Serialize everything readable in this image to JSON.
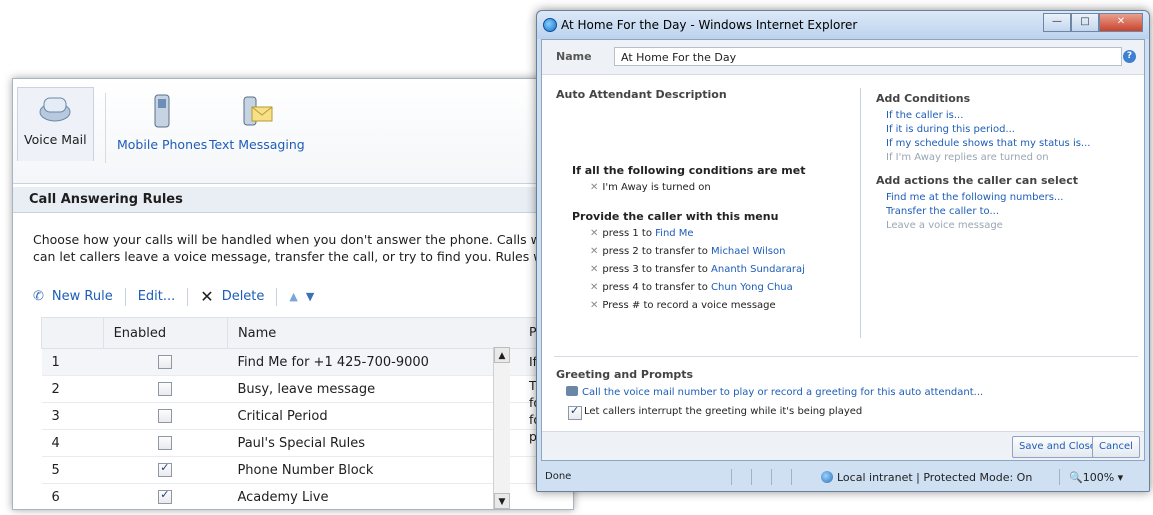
{
  "back_window": {
    "tabs": [
      {
        "label": "Voice Mail",
        "icon": "voicemail-icon"
      },
      {
        "label": "Mobile Phones",
        "icon": "mobile-phone-icon"
      },
      {
        "label": "Text Messaging",
        "icon": "text-message-icon"
      }
    ],
    "section_title": "Call Answering Rules",
    "description_line1": "Choose how your calls will be handled when you don't answer the phone. Calls will be",
    "description_line2": "can let callers leave a voice message, transfer the call, or try to find you. Rules will b",
    "toolbar": {
      "new_rule": "New Rule",
      "edit": "Edit...",
      "delete": "Delete"
    },
    "grid": {
      "columns": [
        "Enabled",
        "Name",
        "Pr"
      ],
      "rows": [
        {
          "num": "1",
          "enabled": false,
          "name": "Find Me for +1 425-700-9000"
        },
        {
          "num": "2",
          "enabled": false,
          "name": "Busy, leave message"
        },
        {
          "num": "3",
          "enabled": false,
          "name": "Critical Period"
        },
        {
          "num": "4",
          "enabled": false,
          "name": "Paul's Special Rules"
        },
        {
          "num": "5",
          "enabled": true,
          "name": "Phone Number Block"
        },
        {
          "num": "6",
          "enabled": true,
          "name": "Academy Live"
        }
      ],
      "preview_fragments": [
        "If",
        "Th",
        "fo",
        "fo",
        "pr"
      ]
    }
  },
  "ie_window": {
    "title": "At Home For the Day - Windows Internet Explorer",
    "name_label": "Name",
    "name_value": "At Home For the Day",
    "aa_title": "Auto Attendant Description",
    "conditions_heading": "If all the following conditions are met",
    "conditions": [
      "I'm Away is turned on"
    ],
    "menu_heading": "Provide the caller with this menu",
    "menu_items": [
      {
        "prefix": "press 1 to ",
        "link": "Find Me"
      },
      {
        "prefix": "press 2 to transfer to ",
        "link": "Michael Wilson"
      },
      {
        "prefix": "press 3 to transfer to ",
        "link": "Ananth Sundararaj"
      },
      {
        "prefix": "press 4 to transfer to ",
        "link": "Chun Yong Chua"
      },
      {
        "prefix": "Press # to record a voice message",
        "link": ""
      }
    ],
    "add_conditions_heading": "Add Conditions",
    "add_conditions": [
      {
        "label": "If the caller is...",
        "dim": false
      },
      {
        "label": "If it is during this period...",
        "dim": false
      },
      {
        "label": "If my schedule shows that my status is...",
        "dim": false
      },
      {
        "label": "If I'm Away replies are turned on",
        "dim": true
      }
    ],
    "add_actions_heading": "Add actions the caller can select",
    "add_actions": [
      {
        "label": "Find me at the following numbers...",
        "dim": false
      },
      {
        "label": "Transfer the caller to...",
        "dim": false
      },
      {
        "label": "Leave a voice message",
        "dim": true
      }
    ],
    "greeting_heading": "Greeting and Prompts",
    "greeting_link": "Call the voice mail number to play or record a greeting for this auto attendant...",
    "interrupt_label": "Let callers interrupt the greeting while it's being played",
    "interrupt_checked": true,
    "save_label": "Save and Close",
    "cancel_label": "Cancel",
    "status_done": "Done",
    "status_zone": "Local intranet | Protected Mode: On",
    "status_zoom": "100%"
  }
}
